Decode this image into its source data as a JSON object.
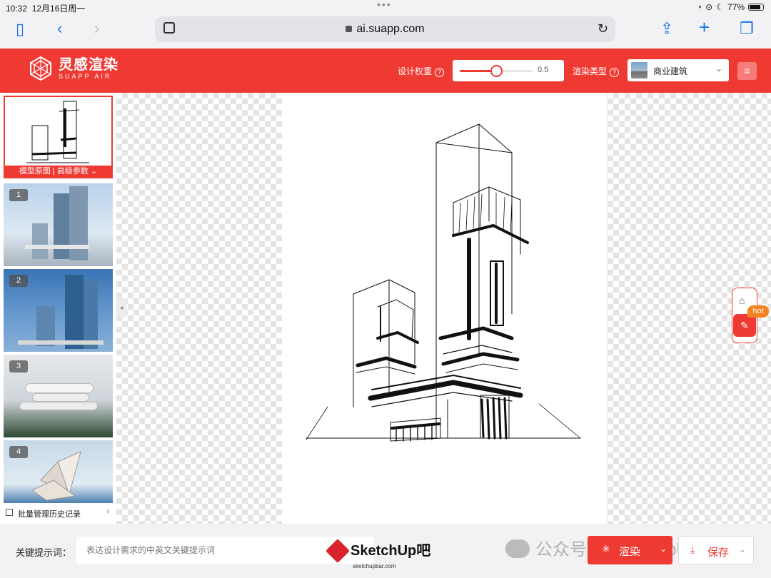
{
  "status": {
    "time": "10:32",
    "date": "12月16日周一",
    "battery": "77%"
  },
  "browser": {
    "url": "ai.suapp.com"
  },
  "header": {
    "brand_name": "灵感渲染",
    "brand_sub": "SUAPP AIR",
    "weight_label": "设计权重",
    "weight_value": "0.5",
    "weight_fraction": 0.5,
    "render_type_label": "渲染类型",
    "render_type_value": "商业建筑"
  },
  "history": {
    "original_caption": "模型原图 | 高级参数",
    "items": [
      {
        "num": "1"
      },
      {
        "num": "2"
      },
      {
        "num": "3"
      },
      {
        "num": "4"
      }
    ],
    "batch_label": "批量管理历史记录"
  },
  "floating": {
    "hot_badge": "hot"
  },
  "prompt": {
    "label": "关键提示词：",
    "placeholder": "表达设计需求的中英文关键提示词"
  },
  "actions": {
    "render_label": "渲染",
    "save_label": "保存"
  },
  "watermarks": {
    "sketchup_logo": "SketchUp吧",
    "sketchup_url": "sketchupbar.com",
    "wechat": "公众号 · SketchUp吧"
  },
  "colors": {
    "brand_red": "#ef3a33",
    "hot_orange": "#f5821f"
  }
}
